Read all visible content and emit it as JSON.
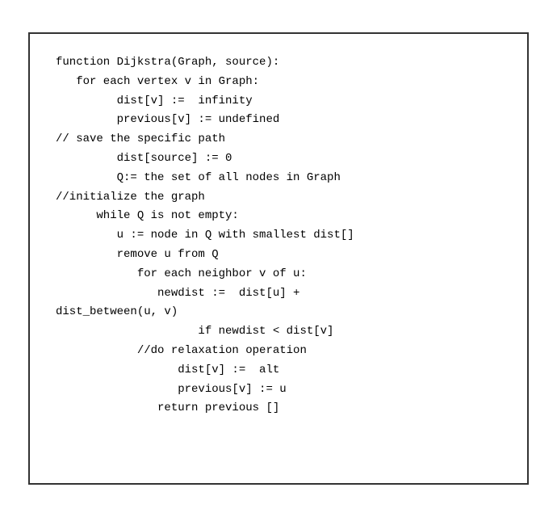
{
  "code": {
    "lines": [
      "function Dijkstra(Graph, source):",
      "   for each vertex v in Graph:",
      "         dist[v] :=  infinity",
      "         previous[v] := undefined",
      "// save the specific path",
      "         dist[source] := 0",
      "         Q:= the set of all nodes in Graph",
      "//initialize the graph",
      "      while Q is not empty:",
      "         u := node in Q with smallest dist[]",
      "         remove u from Q",
      "            for each neighbor v of u:",
      "               newdist :=  dist[u] +",
      "dist_between(u, v)",
      "                     if newdist < dist[v]",
      "            //do relaxation operation",
      "                  dist[v] :=  alt",
      "                  previous[v] := u",
      "               return previous []"
    ]
  }
}
